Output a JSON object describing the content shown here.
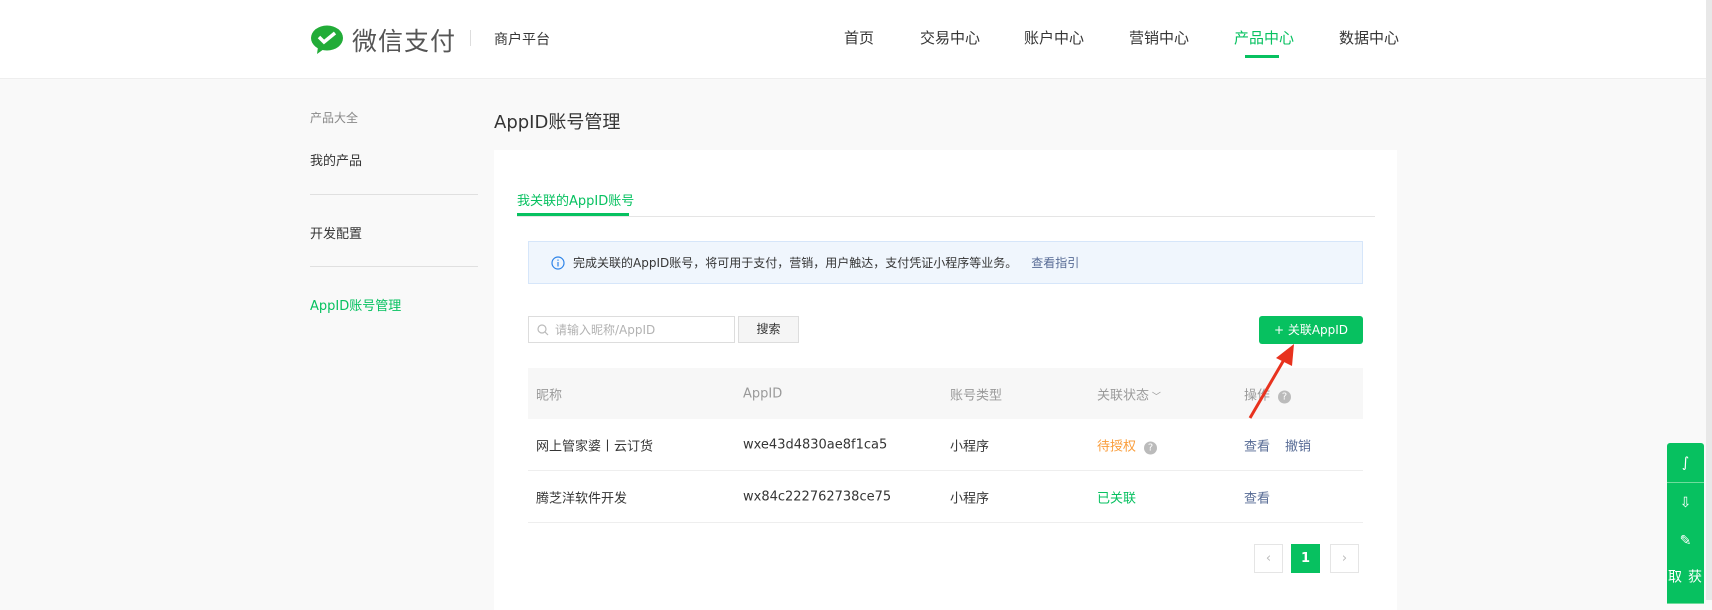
{
  "header": {
    "brand": "微信支付",
    "subtitle": "商户平台",
    "nav": [
      "首页",
      "交易中心",
      "账户中心",
      "营销中心",
      "产品中心",
      "数据中心"
    ],
    "active_nav": "产品中心"
  },
  "sidebar": {
    "items": [
      "产品大全",
      "我的产品",
      "开发配置",
      "AppID账号管理"
    ]
  },
  "page": {
    "title": "AppID账号管理",
    "tab": "我关联的AppID账号",
    "info": "完成关联的AppID账号，将可用于支付，营销，用户触达，支付凭证小程序等业务。",
    "info_link": "查看指引",
    "search_placeholder": "请输入昵称/AppID",
    "search_button": "搜索",
    "add_button": "+ 关联AppID"
  },
  "table": {
    "headers": [
      "昵称",
      "AppID",
      "账号类型",
      "关联状态",
      "操作"
    ],
    "rows": [
      {
        "name": "网上管家婆丨云订货",
        "appid": "wxe43d4830ae8f1ca5",
        "type": "小程序",
        "status": "待授权",
        "actions": [
          "查看",
          "撤销"
        ]
      },
      {
        "name": "腾芝洋软件开发",
        "appid": "wx84c222762738ce75",
        "type": "小程序",
        "status": "已关联",
        "actions": [
          "查看"
        ]
      }
    ]
  },
  "pagination": {
    "current": "1"
  },
  "float_bar": {
    "text": "获取"
  },
  "colors": {
    "brand": "#07c160",
    "pending": "#fa9d3b",
    "link": "#576b95"
  }
}
